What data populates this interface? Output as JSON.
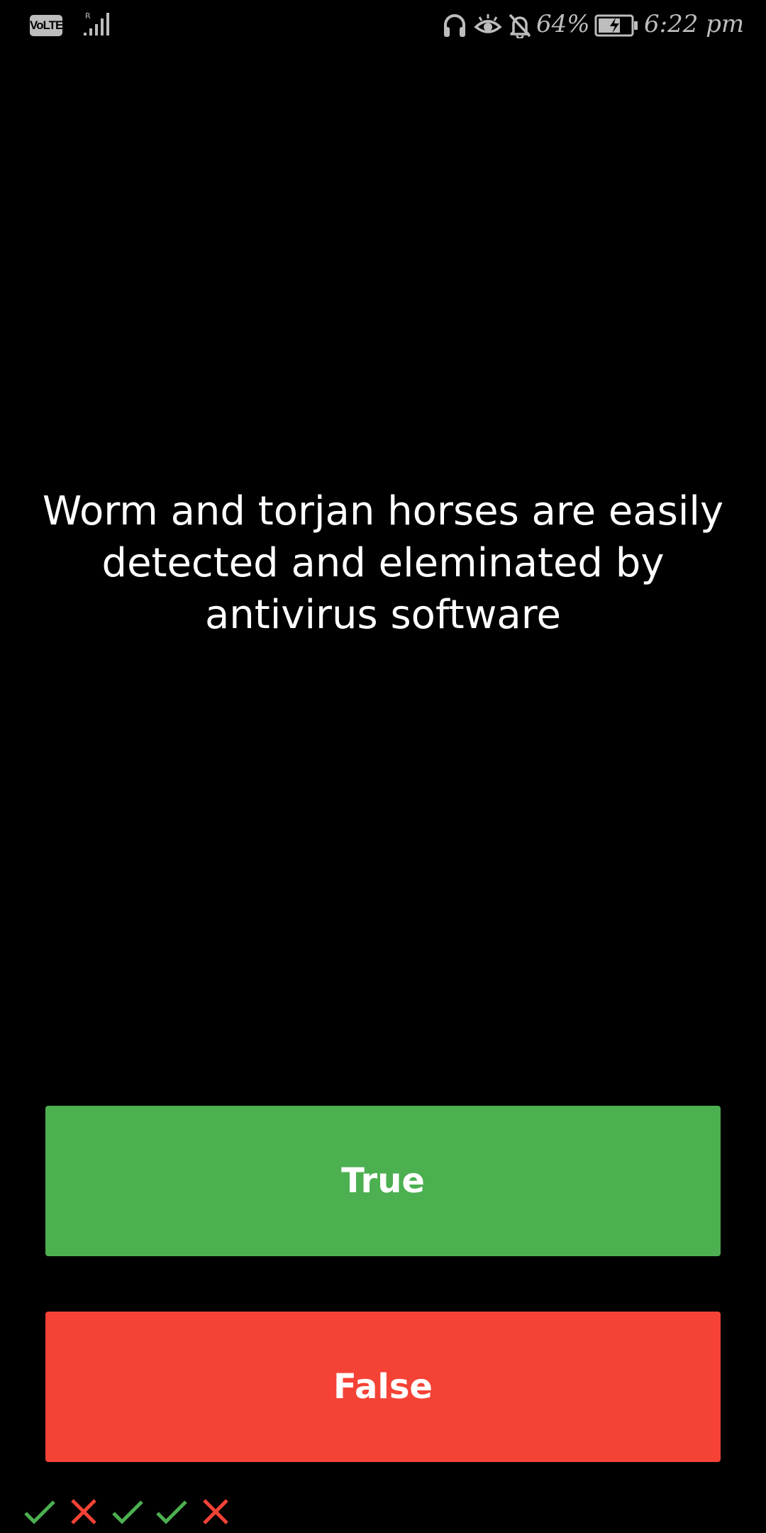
{
  "status_bar": {
    "volte": "VoLTE",
    "icons": [
      "signal-icon",
      "headphones-icon",
      "eye-comfort-icon",
      "notifications-off-icon",
      "battery-charging-icon"
    ],
    "battery_percent": "64%",
    "time": "6:22 pm"
  },
  "quiz": {
    "question": "Worm and torjan horses are easily detected and eleminated by antivirus software",
    "answers": {
      "true_label": "True",
      "false_label": "False"
    },
    "history": [
      "correct",
      "wrong",
      "correct",
      "correct",
      "wrong"
    ]
  },
  "colors": {
    "true_button": "#4caf50",
    "false_button": "#f44336",
    "correct_mark": "#4caf50",
    "wrong_mark": "#f44336"
  }
}
